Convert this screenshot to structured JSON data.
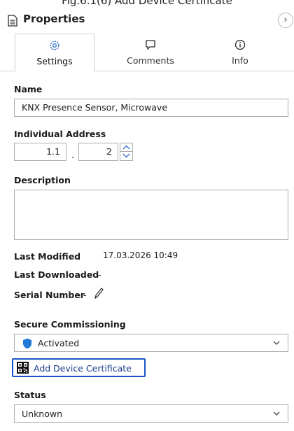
{
  "caption": "Fig.6.1(6) Add Device Certificate",
  "panel": {
    "title": "Properties",
    "collapse_glyph": "›"
  },
  "tabs": [
    {
      "label": "Settings",
      "icon": "gear-icon",
      "active": true
    },
    {
      "label": "Comments",
      "icon": "comment-icon",
      "active": false
    },
    {
      "label": "Info",
      "icon": "info-icon",
      "active": false
    }
  ],
  "name": {
    "label": "Name",
    "value": "KNX Presence Sensor, Microwave"
  },
  "address": {
    "label": "Individual Address",
    "area_line": "1.1",
    "separator": ".",
    "device": "2"
  },
  "description": {
    "label": "Description",
    "value": ""
  },
  "last_modified": {
    "label": "Last Modified",
    "value": "17.03.2026 10:49"
  },
  "last_downloaded": {
    "label": "Last Downloaded",
    "value": "-"
  },
  "serial_number": {
    "label": "Serial Number",
    "value": "-"
  },
  "secure_commissioning": {
    "label": "Secure Commissioning",
    "value": "Activated"
  },
  "add_certificate": {
    "label": "Add Device Certificate"
  },
  "status": {
    "label": "Status",
    "value": "Unknown"
  },
  "colors": {
    "accent": "#1a55c8",
    "shield": "#1e7ad6",
    "border": "#adadad"
  }
}
